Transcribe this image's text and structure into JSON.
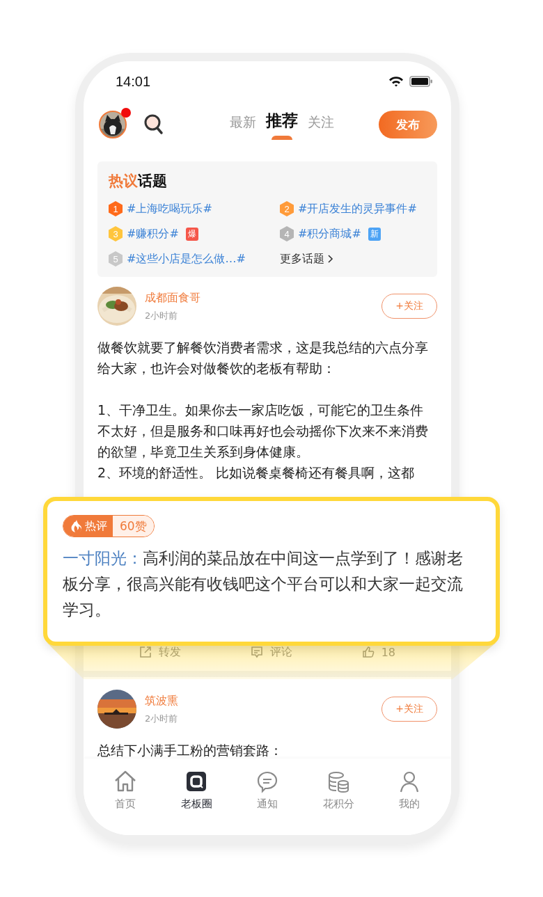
{
  "status_bar": {
    "time": "14:01"
  },
  "header": {
    "avatar_badge": true,
    "tabs": [
      {
        "label": "最新",
        "selected": false
      },
      {
        "label": "推荐",
        "selected": true
      },
      {
        "label": "关注",
        "selected": false
      }
    ],
    "publish_button": "发布"
  },
  "hot_topics": {
    "title_accent": "热议",
    "title_rest": "话题",
    "items": [
      {
        "rank": "1",
        "color": "#ff6a1a",
        "text": "#上海吃喝玩乐#"
      },
      {
        "rank": "2",
        "color": "#ff9b3a",
        "text": "#开店发生的灵异事件#"
      },
      {
        "rank": "3",
        "color": "#ffc53d",
        "text": "#赚积分#",
        "badge": {
          "text": "爆",
          "color": "#f5574a"
        }
      },
      {
        "rank": "4",
        "color": "#b5b5b5",
        "text": "#积分商城#",
        "badge": {
          "text": "新",
          "color": "#4da3f5"
        }
      },
      {
        "rank": "5",
        "color": "#c8c8c8",
        "text": "#这些小店是怎么做…#"
      }
    ],
    "more": "更多话题"
  },
  "posts": [
    {
      "author": "成都面食哥",
      "time": "2小时前",
      "follow": "+关注",
      "paragraphs": [
        "做餐饮就要了解餐饮消费者需求，这是我总结的六点分享给大家，也许会对做餐饮的老板有帮助：",
        "1、干净卫生。如果你去一家店吃饭，可能它的卫生条件不太好，但是服务和口味再好也会动摇你下次来不来消费的欲望，毕竟卫生关系到身体健康。",
        "2、环境的舒适性。 比如说餐桌餐椅还有餐具啊，这都"
      ],
      "actions": [
        {
          "kind": "share",
          "label": "转发"
        },
        {
          "kind": "comment",
          "label": "评论"
        },
        {
          "kind": "like",
          "label": "18"
        }
      ]
    },
    {
      "author": "筑波熏",
      "time": "2小时前",
      "follow": "+关注",
      "paragraphs": [
        "总结下小满手工粉的营销套路："
      ]
    }
  ],
  "hot_comment": {
    "tag": "热评",
    "likes": "60赞",
    "author": "一寸阳光：",
    "text": "高利润的菜品放在中间这一点学到了！感谢老板分享，很高兴能有收钱吧这个平台可以和大家一起交流学习。"
  },
  "tab_bar": [
    {
      "kind": "home",
      "label": "首页",
      "selected": false
    },
    {
      "kind": "circle",
      "label": "老板圈",
      "selected": true
    },
    {
      "kind": "notice",
      "label": "通知",
      "selected": false
    },
    {
      "kind": "points",
      "label": "花积分",
      "selected": false
    },
    {
      "kind": "me",
      "label": "我的",
      "selected": false
    }
  ]
}
